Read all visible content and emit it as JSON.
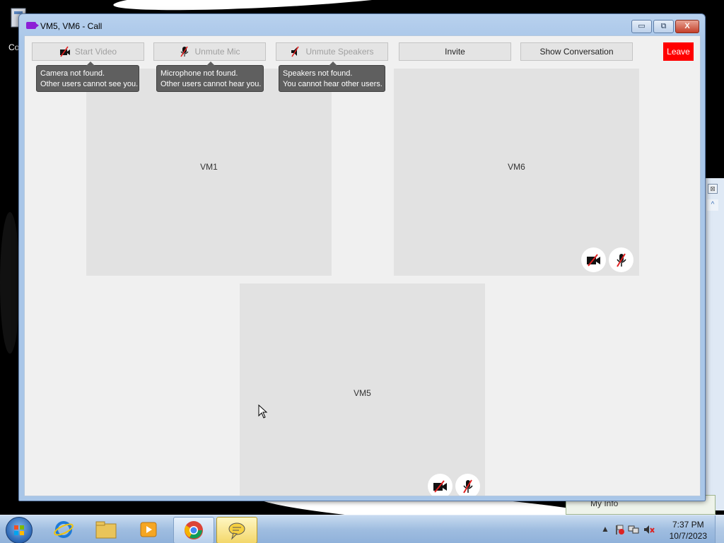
{
  "desktop": {
    "icon_label": "Co"
  },
  "background_window": {
    "close_glyph": "⊠",
    "scroll_up_glyph": "^",
    "my_info_label": "My Info"
  },
  "window": {
    "title": "VM5, VM6 - Call",
    "minimize": "▭",
    "maximize": "⧉",
    "close": "X"
  },
  "toolbar": {
    "start_video": "Start Video",
    "unmute_mic": "Unmute Mic",
    "unmute_speakers": "Unmute Speakers",
    "invite": "Invite",
    "show_conversation": "Show Conversation",
    "leave": "Leave"
  },
  "tooltips": {
    "camera": [
      "Camera not found.",
      "Other users cannot see you."
    ],
    "mic": [
      "Microphone not found.",
      "Other users cannot hear you."
    ],
    "speakers": [
      "Speakers not found.",
      "You cannot hear other users."
    ]
  },
  "participants": [
    {
      "name": "VM1"
    },
    {
      "name": "VM6"
    },
    {
      "name": "VM5"
    }
  ],
  "taskbar": {
    "items": [
      "internet-explorer",
      "windows-explorer",
      "media-player",
      "chrome",
      "chat-app"
    ],
    "time": "7:37 PM",
    "date": "10/7/2023"
  },
  "colors": {
    "leave": "#ff0000",
    "tile": "#e2e2e2",
    "tooltip": "#5f5f5f",
    "title_icon": "#8c1fd6"
  }
}
